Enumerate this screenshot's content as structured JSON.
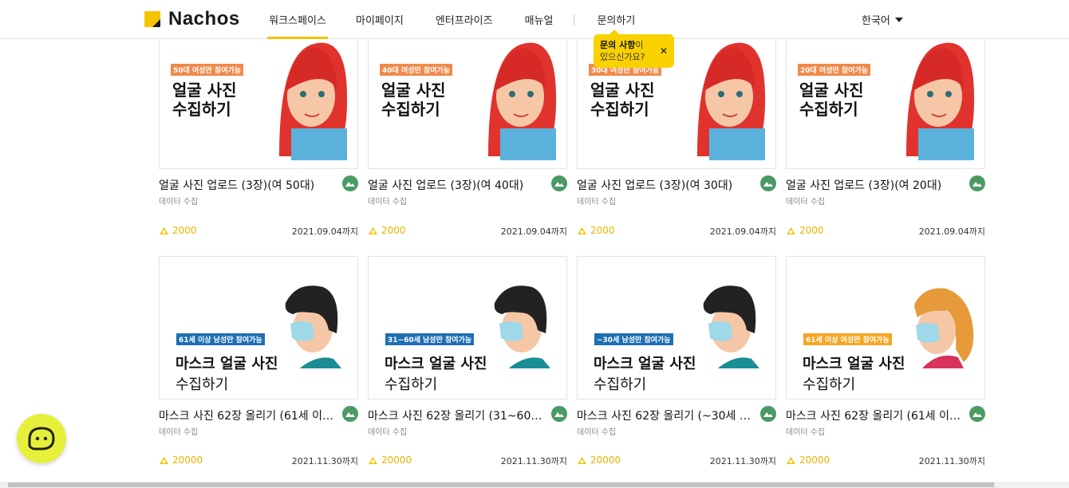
{
  "header": {
    "logo_text": "Nachos",
    "nav": [
      "워크스페이스",
      "마이페이지",
      "엔터프라이즈",
      "매뉴얼",
      "문의하기"
    ],
    "language": "한국어"
  },
  "tooltip": {
    "bold": "문의 사항",
    "text1": "이",
    "text2": "있으신가요?",
    "close": "✕"
  },
  "cards": [
    {
      "tag": "50대 여성만 참여가능",
      "line1": "얼굴 사진",
      "line2": "수집하기",
      "title": "얼굴 사진 업로드 (3장)(여 50대)",
      "sub": "데이터 수집",
      "points": "2000",
      "deadline": "2021.09.04까지"
    },
    {
      "tag": "40대 여성만 참여가능",
      "line1": "얼굴 사진",
      "line2": "수집하기",
      "title": "얼굴 사진 업로드 (3장)(여 40대)",
      "sub": "데이터 수집",
      "points": "2000",
      "deadline": "2021.09.04까지"
    },
    {
      "tag": "30대 여성만 참여가능",
      "line1": "얼굴 사진",
      "line2": "수집하기",
      "title": "얼굴 사진 업로드 (3장)(여 30대)",
      "sub": "데이터 수집",
      "points": "2000",
      "deadline": "2021.09.04까지"
    },
    {
      "tag": "20대 여성만 참여가능",
      "line1": "얼굴 사진",
      "line2": "수집하기",
      "title": "얼굴 사진 업로드 (3장)(여 20대)",
      "sub": "데이터 수집",
      "points": "2000",
      "deadline": "2021.09.04까지"
    },
    {
      "tag": "61세 이상 남성만 참여가능",
      "line1": "마스크 얼굴 사진",
      "line2": "수집하기",
      "title": "마스크 사진 62장 올리기 (61세 이…",
      "sub": "데이터 수집",
      "points": "20000",
      "deadline": "2021.11.30까지"
    },
    {
      "tag": "31~60세 남성만 참여가능",
      "line1": "마스크 얼굴 사진",
      "line2": "수집하기",
      "title": "마스크 사진 62장 올리기 (31~60…",
      "sub": "데이터 수집",
      "points": "20000",
      "deadline": "2021.11.30까지"
    },
    {
      "tag": "~30세 남성만 참여가능",
      "line1": "마스크 얼굴 사진",
      "line2": "수집하기",
      "title": "마스크 사진 62장 올리기 (~30세 …",
      "sub": "데이터 수집",
      "points": "20000",
      "deadline": "2021.11.30까지"
    },
    {
      "tag": "61세 이상 여성만 참여가능",
      "line1": "마스크 얼굴 사진",
      "line2": "수집하기",
      "title": "마스크 사진 62장 올리기 (61세 이…",
      "sub": "데이터 수집",
      "points": "20000",
      "deadline": "2021.11.30까지"
    }
  ],
  "colors": {
    "brand_yellow": "#f5c400",
    "tag_orange": "#f08a4b",
    "tag_blue": "#1f6fb2",
    "tag_amber": "#f5a623",
    "badge_green": "#4a9a64",
    "points_yellow": "#e8b400"
  },
  "icons": {
    "badge": "mountain-image-icon",
    "points": "coin-icon",
    "chat": "chat-bubble-icon",
    "language": "caret-down-icon"
  }
}
